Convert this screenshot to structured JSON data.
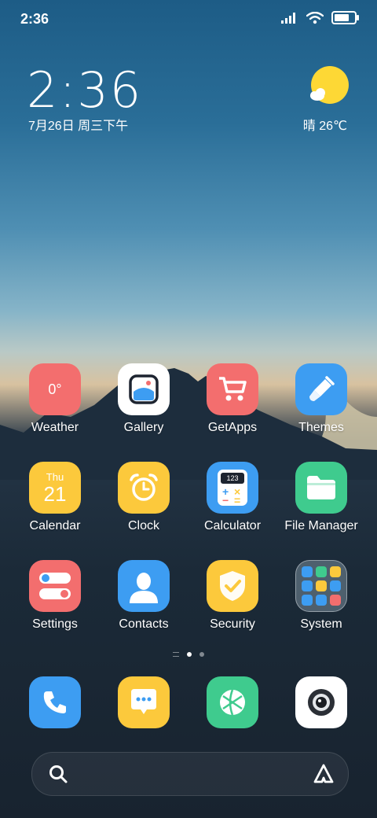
{
  "status": {
    "time": "2:36"
  },
  "clock": {
    "time": "2:36",
    "date": "7月26日 周三下午"
  },
  "weather": {
    "condition": "晴",
    "temp": "26℃",
    "icon": "sun-cloud-icon"
  },
  "apps": [
    {
      "label": "Weather",
      "icon_text": "0°",
      "color": "#f36e6e"
    },
    {
      "label": "Gallery",
      "color": "#ffffff"
    },
    {
      "label": "GetApps",
      "color": "#f36e6e"
    },
    {
      "label": "Themes",
      "color": "#3d9df2"
    },
    {
      "label": "Calendar",
      "day": "Thu",
      "date": "21",
      "color": "#fcc93c"
    },
    {
      "label": "Clock",
      "color": "#fcc93c"
    },
    {
      "label": "Calculator",
      "screen": "123",
      "color": "#3d9df2"
    },
    {
      "label": "File Manager",
      "color": "#3fcb8e"
    },
    {
      "label": "Settings",
      "color": "#f36e6e"
    },
    {
      "label": "Contacts",
      "color": "#3d9df2"
    },
    {
      "label": "Security",
      "color": "#fcc93c"
    },
    {
      "label": "System",
      "color": "#6b7780"
    }
  ],
  "dock": [
    {
      "name": "phone",
      "color": "#3d9df2"
    },
    {
      "name": "messages",
      "color": "#fcc93c"
    },
    {
      "name": "browser",
      "color": "#3fcb8e"
    },
    {
      "name": "camera",
      "color": "#ffffff"
    }
  ],
  "pages": {
    "count": 2,
    "active": 1
  },
  "battery_level": 0.9
}
